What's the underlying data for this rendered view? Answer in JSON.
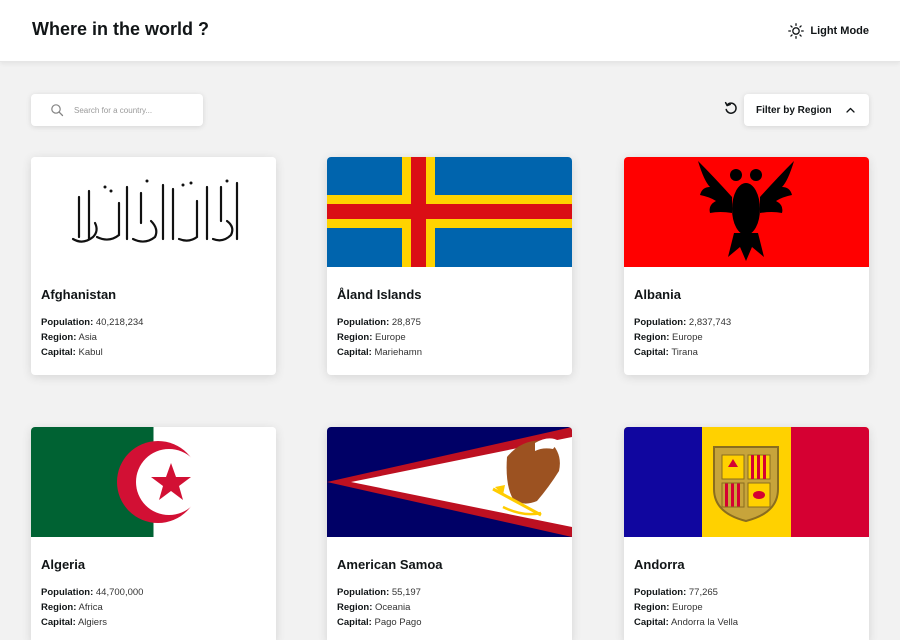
{
  "header": {
    "title": "Where in the world ?",
    "mode_label": "Light Mode"
  },
  "search": {
    "placeholder": "Search for a country..."
  },
  "filter": {
    "label": "Filter by Region"
  },
  "fields": {
    "population": "Population:",
    "region": "Region:",
    "capital": "Capital:"
  },
  "countries": [
    {
      "name": "Afghanistan",
      "population": "40,218,234",
      "region": "Asia",
      "capital": "Kabul"
    },
    {
      "name": "Åland Islands",
      "population": "28,875",
      "region": "Europe",
      "capital": "Mariehamn"
    },
    {
      "name": "Albania",
      "population": "2,837,743",
      "region": "Europe",
      "capital": "Tirana"
    },
    {
      "name": "Algeria",
      "population": "44,700,000",
      "region": "Africa",
      "capital": "Algiers"
    },
    {
      "name": "American Samoa",
      "population": "55,197",
      "region": "Oceania",
      "capital": "Pago Pago"
    },
    {
      "name": "Andorra",
      "population": "77,265",
      "region": "Europe",
      "capital": "Andorra la Vella"
    }
  ],
  "colors": {
    "background": "#f2f2f2",
    "card": "#ffffff",
    "text": "#111517"
  }
}
